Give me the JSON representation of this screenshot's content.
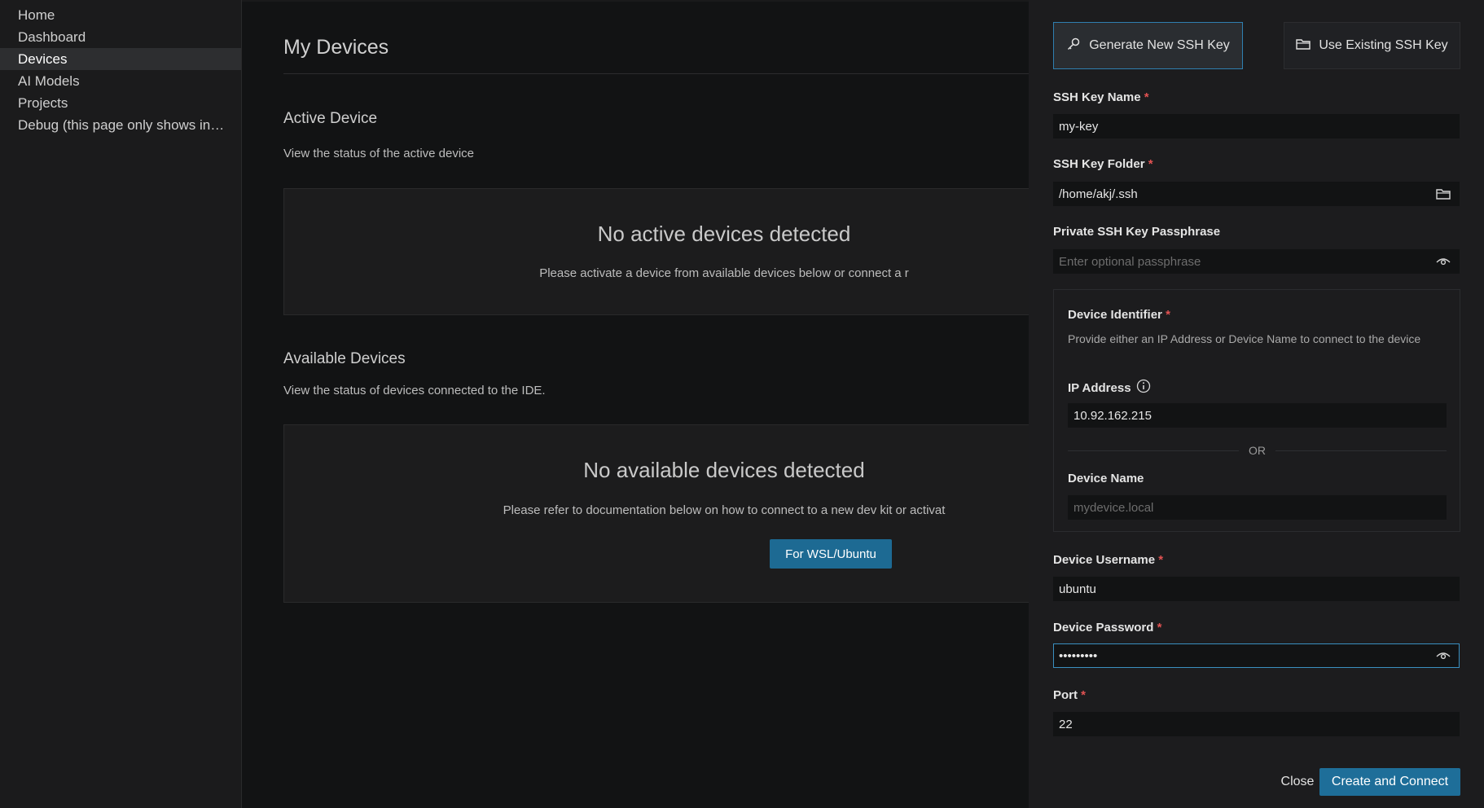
{
  "sidebar": {
    "items": [
      {
        "label": "Home",
        "active": false
      },
      {
        "label": "Dashboard",
        "active": false
      },
      {
        "label": "Devices",
        "active": true
      },
      {
        "label": "AI Models",
        "active": false
      },
      {
        "label": "Projects",
        "active": false
      },
      {
        "label": "Debug (this page only shows in d...",
        "active": false
      }
    ]
  },
  "main": {
    "title": "My Devices",
    "active_section": {
      "title": "Active Device",
      "description": "View the status of the active device",
      "empty_title": "No active devices detected",
      "empty_text": "Please activate a device from available devices below or connect a r"
    },
    "available_section": {
      "title": "Available Devices",
      "description": "View the status of devices connected to the IDE.",
      "empty_title": "No available devices detected",
      "empty_text": "Please refer to documentation below on how to connect to a new dev kit or activat",
      "wsl_button": "For WSL/Ubuntu"
    }
  },
  "panel": {
    "generate_key_label": "Generate New SSH Key",
    "use_existing_label": "Use Existing SSH Key",
    "ssh_key_name": {
      "label": "SSH Key Name",
      "value": "my-key"
    },
    "ssh_key_folder": {
      "label": "SSH Key Folder",
      "value": "/home/akj/.ssh"
    },
    "passphrase": {
      "label": "Private SSH Key Passphrase",
      "placeholder": "Enter optional passphrase"
    },
    "identifier": {
      "title": "Device Identifier",
      "description": "Provide either an IP Address or Device Name to connect to the device",
      "ip_label": "IP Address",
      "ip_value": "10.92.162.215",
      "or_text": "OR",
      "name_label": "Device Name",
      "name_placeholder": "mydevice.local"
    },
    "username": {
      "label": "Device Username",
      "value": "ubuntu"
    },
    "password": {
      "label": "Device Password",
      "value": "•••••••••"
    },
    "port": {
      "label": "Port",
      "value": "22"
    },
    "close_label": "Close",
    "create_label": "Create and Connect",
    "required_mark": "*"
  },
  "colors": {
    "accent": "#1e6e99",
    "focus": "#3a8fc0",
    "required": "#e25252"
  }
}
